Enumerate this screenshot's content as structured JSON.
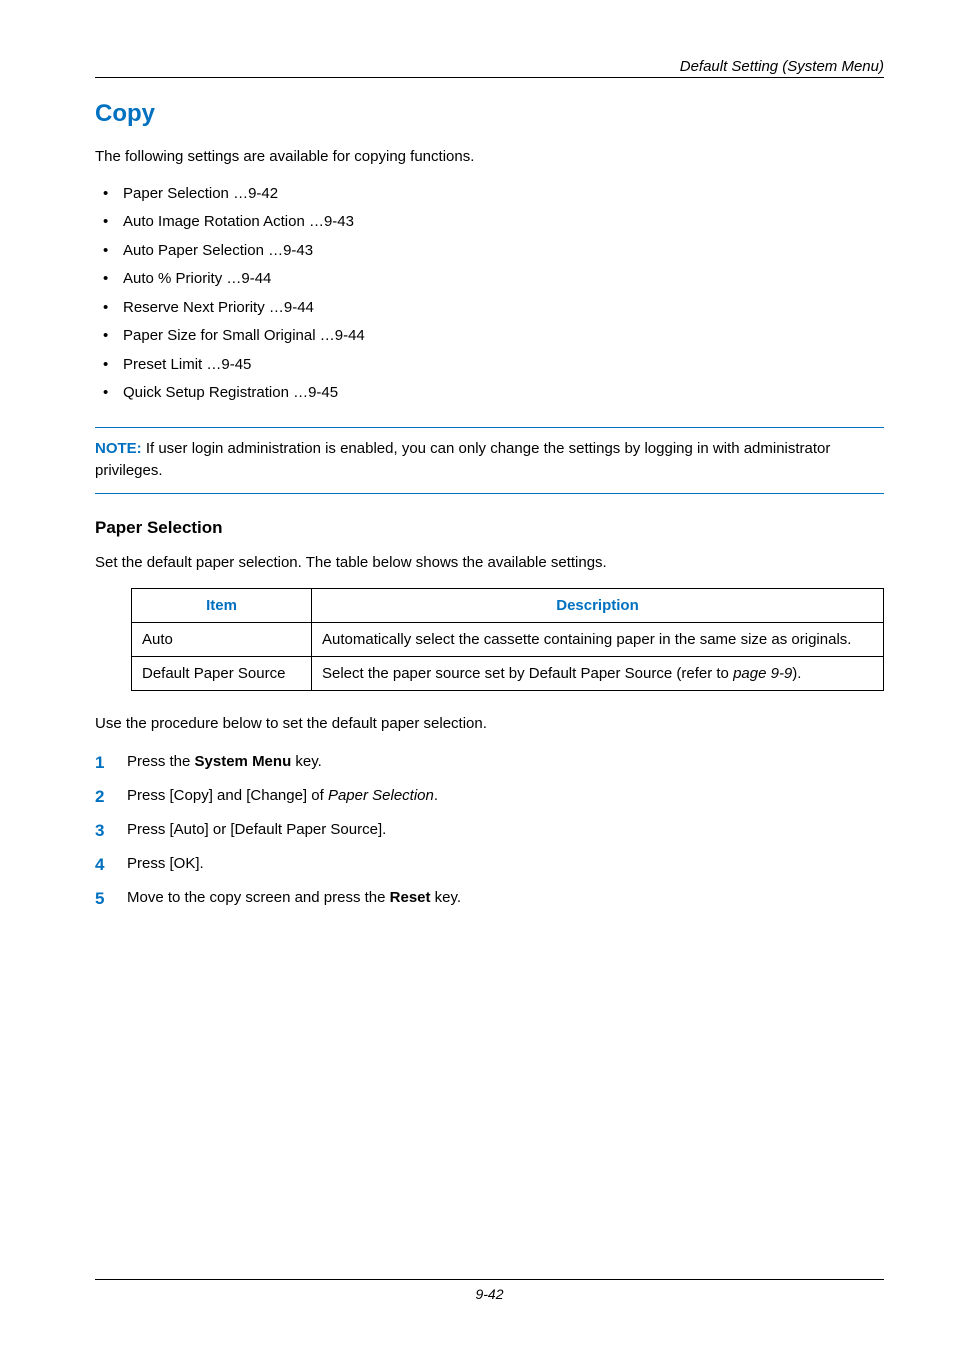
{
  "header": {
    "title": "Default Setting (System Menu)"
  },
  "section": {
    "title": "Copy",
    "intro": "The following settings are available for copying functions."
  },
  "bullets": [
    "Paper Selection …9-42",
    "Auto Image Rotation Action …9-43",
    "Auto Paper Selection …9-43",
    "Auto % Priority …9-44",
    "Reserve Next Priority …9-44",
    "Paper Size for Small Original …9-44",
    "Preset Limit …9-45",
    "Quick Setup Registration …9-45"
  ],
  "note": {
    "label": "NOTE:",
    "text": " If user login administration is enabled, you can only change the settings by logging in with administrator privileges."
  },
  "subsection": {
    "title": "Paper Selection",
    "intro": "Set the default paper selection. The table below shows the available settings."
  },
  "table": {
    "headers": {
      "item": "Item",
      "description": "Description"
    },
    "rows": [
      {
        "item": "Auto",
        "desc": "Automatically select the cassette containing paper in the same size as originals."
      },
      {
        "item": "Default Paper Source",
        "desc_pre": "Select the paper source set by Default Paper Source (refer to ",
        "desc_em": "page 9-9",
        "desc_post": ")."
      }
    ]
  },
  "procedure": {
    "intro": "Use the procedure below to set the default paper selection.",
    "steps": [
      {
        "pre": "Press the ",
        "bold": "System Menu",
        "post": " key."
      },
      {
        "pre": "Press [Copy] and [Change] of ",
        "em": "Paper Selection",
        "post": "."
      },
      {
        "text": "Press [Auto] or [Default Paper Source]."
      },
      {
        "text": "Press [OK]."
      },
      {
        "pre": "Move to the copy screen and press the ",
        "bold": "Reset",
        "post": " key."
      }
    ]
  },
  "footer": {
    "page": "9-42"
  }
}
